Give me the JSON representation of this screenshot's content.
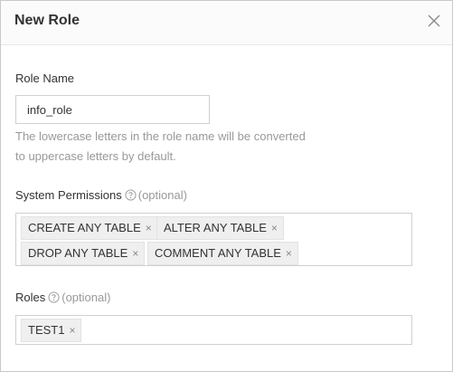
{
  "dialog": {
    "title": "New Role",
    "close_icon": "close-icon"
  },
  "role_name": {
    "label": "Role Name",
    "value": "info_role",
    "hint_line1": "The lowercase letters in the role name will be converted",
    "hint_line2": "to uppercase letters by default."
  },
  "system_permissions": {
    "label": "System Permissions",
    "optional": "(optional)",
    "help_icon": "question-circle-icon",
    "tags": [
      "CREATE ANY TABLE",
      "ALTER ANY TABLE",
      "DROP ANY TABLE",
      "COMMENT ANY TABLE"
    ]
  },
  "roles": {
    "label": "Roles",
    "optional": "(optional)",
    "help_icon": "question-circle-icon",
    "tags": [
      "TEST1"
    ]
  },
  "tag_remove_glyph": "×"
}
